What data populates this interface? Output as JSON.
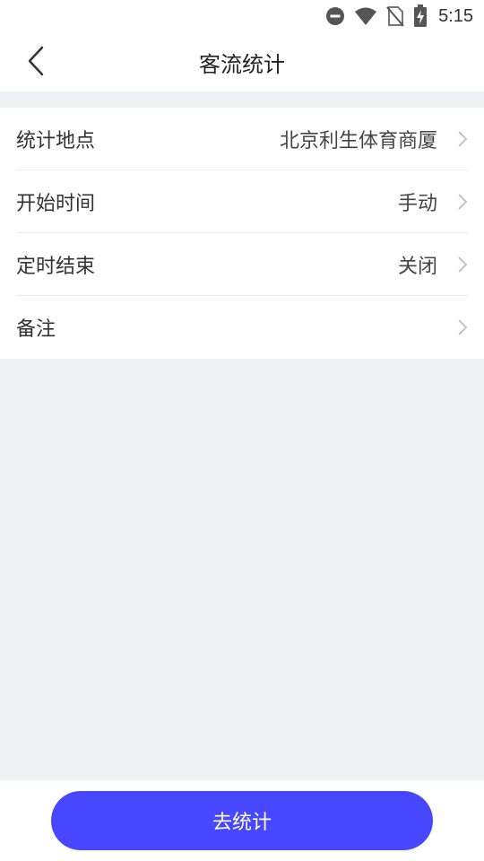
{
  "status_bar": {
    "time": "5:15",
    "icons": [
      "do-not-disturb-icon",
      "wifi-icon",
      "no-sim-icon",
      "battery-charging-icon"
    ]
  },
  "header": {
    "back_icon": "chevron-left-icon",
    "title": "客流统计"
  },
  "settings": {
    "items": [
      {
        "label": "统计地点",
        "value": "北京利生体育商厦"
      },
      {
        "label": "开始时间",
        "value": "手动"
      },
      {
        "label": "定时结束",
        "value": "关闭"
      },
      {
        "label": "备注",
        "value": ""
      }
    ]
  },
  "footer": {
    "button_label": "去统计"
  },
  "colors": {
    "accent": "#4747ff",
    "background": "#f0f1f5",
    "surface": "#ffffff"
  }
}
